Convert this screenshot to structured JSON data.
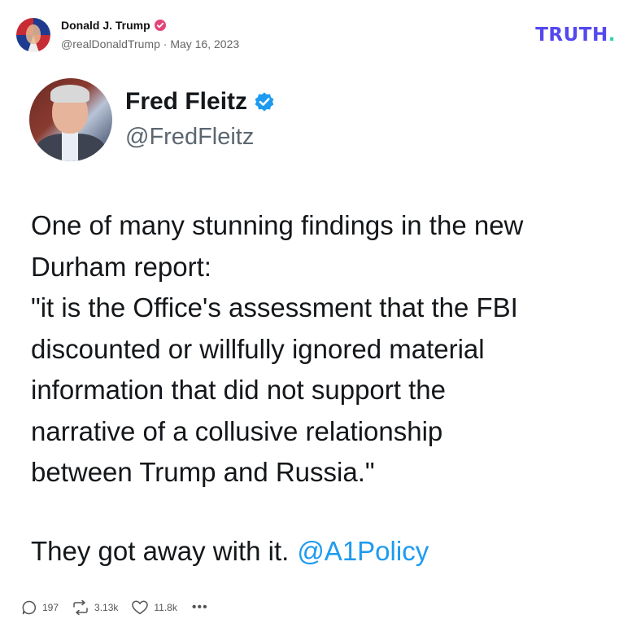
{
  "post": {
    "author_name": "Donald J. Trump",
    "handle": "@realDonaldTrump",
    "separator": "·",
    "date": "May 16, 2023",
    "verified_icon": "verified-badge-icon",
    "logo_text": "TRUTH",
    "logo_dot": ".",
    "colors": {
      "logo": "#5448ee",
      "logo_dot": "#33d0b5",
      "verified": "#e3457a"
    }
  },
  "embedded_tweet": {
    "name": "Fred Fleitz",
    "handle": "@FredFleitz",
    "body_lines": [
      "One of many stunning findings in the new",
      "Durham report:",
      "\"it is the Office's assessment that the FBI",
      "discounted or willfully ignored material",
      "information that did not support the",
      "narrative of a collusive relationship",
      "between Trump and Russia.\""
    ],
    "tail_text": "They got away with it.",
    "mention": "@A1Policy",
    "colors": {
      "mention": "#1d9bf0",
      "verified": "#1d9bf0"
    }
  },
  "actions": {
    "replies": "197",
    "retruths": "3.13k",
    "likes": "11.8k",
    "more": "•••",
    "icons": [
      "reply-icon",
      "retruth-icon",
      "like-icon",
      "more-icon"
    ]
  }
}
